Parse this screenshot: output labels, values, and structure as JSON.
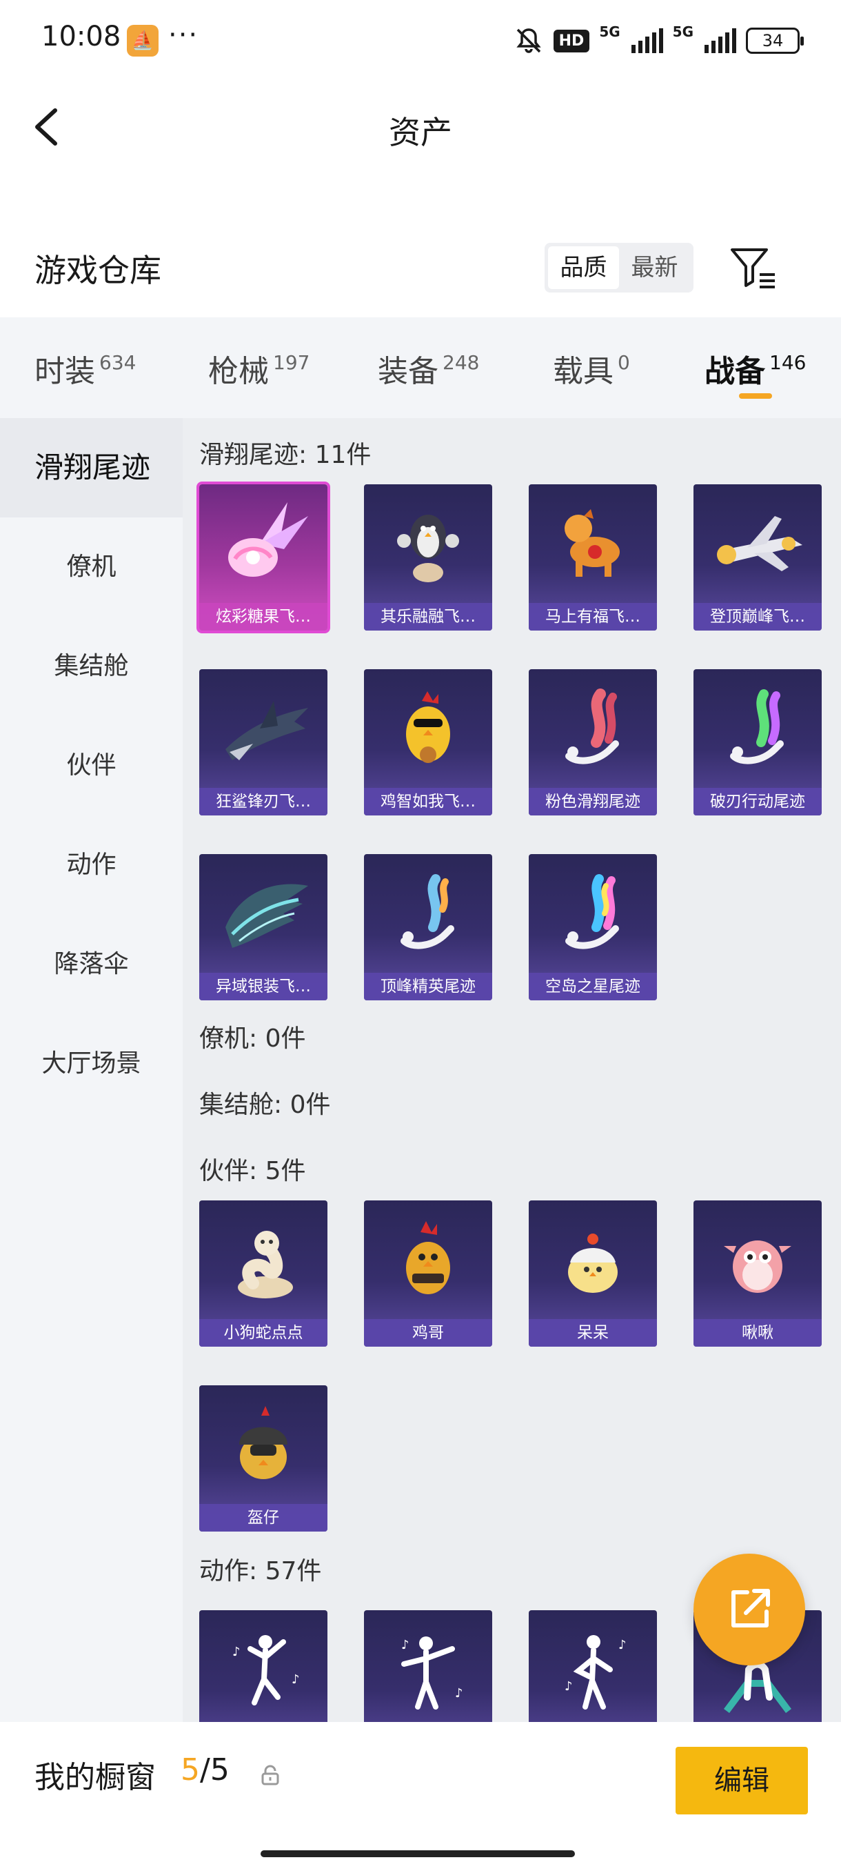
{
  "status_bar": {
    "time": "10:08",
    "dots": "···",
    "hd": "HD",
    "net1": "5G",
    "net2": "5G",
    "battery": "34"
  },
  "nav": {
    "title": "资产"
  },
  "warehouse": {
    "title": "游戏仓库",
    "sort_options": [
      "品质",
      "最新"
    ],
    "active_sort": "品质"
  },
  "tabs": [
    {
      "label": "时装",
      "count": "634"
    },
    {
      "label": "枪械",
      "count": "197"
    },
    {
      "label": "装备",
      "count": "248"
    },
    {
      "label": "载具",
      "count": "0"
    },
    {
      "label": "战备",
      "count": "146"
    }
  ],
  "active_tab": "战备",
  "sidebar": [
    "滑翔尾迹",
    "僚机",
    "集结舱",
    "伙伴",
    "动作",
    "降落伞",
    "大厅场景"
  ],
  "sections": {
    "trails": {
      "title": "滑翔尾迹: 11件",
      "items": [
        "炫彩糖果飞…",
        "其乐融融飞…",
        "马上有福飞…",
        "登顶巅峰飞…",
        "狂鲨锋刃飞…",
        "鸡智如我飞…",
        "粉色滑翔尾迹",
        "破刃行动尾迹",
        "异域银装飞…",
        "顶峰精英尾迹",
        "空岛之星尾迹"
      ]
    },
    "wingman": {
      "title": "僚机: 0件"
    },
    "pod": {
      "title": "集结舱: 0件"
    },
    "partner": {
      "title": "伙伴: 5件",
      "items": [
        "小狗蛇点点",
        "鸡哥",
        "呆呆",
        "啾啾",
        "盔仔"
      ]
    },
    "emote": {
      "title": "动作: 57件"
    }
  },
  "bottom": {
    "label": "我的橱窗",
    "count_current": "5",
    "count_total": "/5",
    "edit_label": "编辑"
  },
  "colors": {
    "accent": "#f5a623",
    "card_bg": "#2b2758",
    "card_selected": "#d14fc2"
  }
}
